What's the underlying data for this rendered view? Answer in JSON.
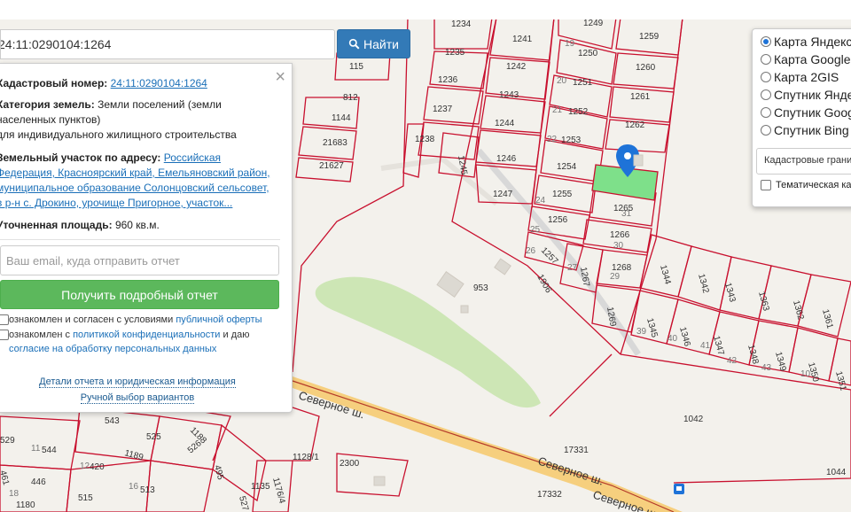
{
  "topbar": {
    "text": "— ..."
  },
  "search": {
    "value": "24:11:0290104:1264",
    "button_label": "Найти"
  },
  "info_panel": {
    "cadastral_label": "Кадастровый номер:",
    "cadastral_value": "24:11:0290104:1264",
    "category_label": "Категория земель:",
    "category_value_line1": "Земли поселений (земли",
    "category_value_line2": "населенных пунктов)",
    "category_purpose": "для индивидуального жилищного строительства",
    "address_label": "Земельный участок по адресу:",
    "address_line1": "Российская",
    "address_line2": "Федерация, Красноярский край, Емельяновский район,",
    "address_line3": "муниципальное образование Солонцовский сельсовет,",
    "address_line4": "в р-н с. Дрокино, урочище Пригорное, участок...",
    "area_label": "Уточненная площадь:",
    "area_value": "960 кв.м.",
    "email_placeholder": "Ваш email, куда отправить отчет",
    "report_button": "Получить подробный отчет",
    "consent1_text": "ознакомлен и согласен с условиями ",
    "consent1_link": "публичной оферты",
    "consent2_text": "ознакомлен с ",
    "consent2_link": "политикой конфиденциальности",
    "consent2_tail": " и даю",
    "consent2_link2": "согласие на обработку персональных данных",
    "details_link": "Детали отчета и юридическая информация",
    "manual_link": "Ручной выбор вариантов"
  },
  "layers": {
    "options": [
      "Карта Яндекс",
      "Карта Google",
      "Карта 2GIS",
      "Спутник Яндекс",
      "Спутник Google",
      "Спутник Bing"
    ],
    "selected": 0,
    "select_label": "Кадастровые границы",
    "thematic_label": "Тематическая карта"
  },
  "map": {
    "selected_parcel": "1264",
    "parcels": [
      "1234",
      "1241",
      "1249",
      "1259",
      "1250",
      "1235",
      "1242",
      "1260",
      "1251",
      "1236",
      "1243",
      "1261",
      "1252",
      "1237",
      "1244",
      "1262",
      "1253",
      "1238",
      "1245",
      "1246",
      "1254",
      "1255",
      "1247",
      "1265",
      "1256",
      "1266",
      "1257",
      "1267",
      "1268",
      "1269",
      "1144",
      "21683",
      "21627",
      "1344",
      "1342",
      "1343",
      "1363",
      "1362",
      "1361",
      "1345",
      "1346",
      "1347",
      "1348",
      "1349",
      "1350",
      "1351",
      "115",
      "812",
      "953",
      "1906",
      "1042",
      "17331",
      "17332",
      "1044",
      "543",
      "529",
      "544",
      "525",
      "1188",
      "526",
      "495",
      "1189",
      "420",
      "446",
      "513",
      "461",
      "515",
      "1180",
      "1128/1",
      "2300",
      "1176/4",
      "527",
      "1135"
    ],
    "parcel_sub": [
      "19",
      "20",
      "21",
      "22",
      "24",
      "25",
      "26",
      "27",
      "29",
      "30",
      "31",
      "39",
      "40",
      "41",
      "42",
      "43",
      "10",
      "11",
      "12",
      "16",
      "18"
    ],
    "streets": [
      "Северное ш.",
      "Северное ш.",
      "Северное ш."
    ]
  },
  "colors": {
    "parcel_border": "#c8102e",
    "selected_fill": "#7ee08a",
    "marker": "#1e73d8",
    "road": "#f6cf7e",
    "green_area": "#cfe8b8"
  }
}
